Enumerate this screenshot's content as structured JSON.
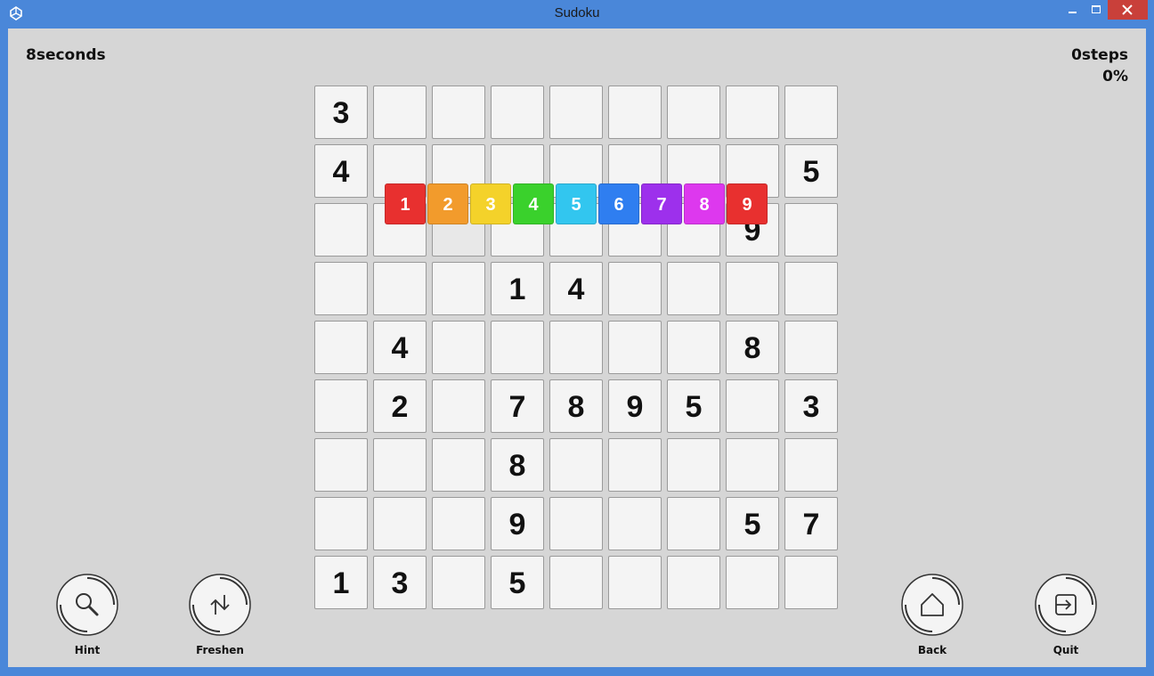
{
  "window": {
    "title": "Sudoku"
  },
  "hud": {
    "timer": "8seconds",
    "steps": "0steps",
    "progress": "0%"
  },
  "board": {
    "rows": [
      [
        "3",
        "",
        "",
        "",
        "",
        "",
        "",
        "",
        ""
      ],
      [
        "4",
        "",
        "",
        "",
        "",
        "",
        "",
        "",
        "5"
      ],
      [
        "",
        "",
        "",
        "",
        "",
        "",
        "",
        "9",
        ""
      ],
      [
        "",
        "",
        "",
        "1",
        "4",
        "",
        "",
        "",
        ""
      ],
      [
        "",
        "4",
        "",
        "",
        "",
        "",
        "",
        "8",
        ""
      ],
      [
        "",
        "2",
        "",
        "7",
        "8",
        "9",
        "5",
        "",
        "3"
      ],
      [
        "",
        "",
        "",
        "8",
        "",
        "",
        "",
        "",
        ""
      ],
      [
        "",
        "",
        "",
        "9",
        "",
        "",
        "",
        "5",
        "7"
      ],
      [
        "1",
        "3",
        "",
        "5",
        "",
        "",
        "",
        "",
        ""
      ]
    ],
    "selected_cell": [
      2,
      2
    ]
  },
  "number_picker": [
    {
      "label": "1",
      "color": "#e8302f"
    },
    {
      "label": "2",
      "color": "#f29b2c"
    },
    {
      "label": "3",
      "color": "#f4d22a"
    },
    {
      "label": "4",
      "color": "#3ad12c"
    },
    {
      "label": "5",
      "color": "#32c6ef"
    },
    {
      "label": "6",
      "color": "#2f7ef0"
    },
    {
      "label": "7",
      "color": "#9d30ec"
    },
    {
      "label": "8",
      "color": "#dd38ee"
    },
    {
      "label": "9",
      "color": "#e8302f"
    }
  ],
  "controls": {
    "hint": {
      "label": "Hint",
      "icon": "magnifier-icon"
    },
    "freshen": {
      "label": "Freshen",
      "icon": "swap-arrows-icon"
    },
    "back": {
      "label": "Back",
      "icon": "home-icon"
    },
    "quit": {
      "label": "Quit",
      "icon": "exit-icon"
    }
  }
}
